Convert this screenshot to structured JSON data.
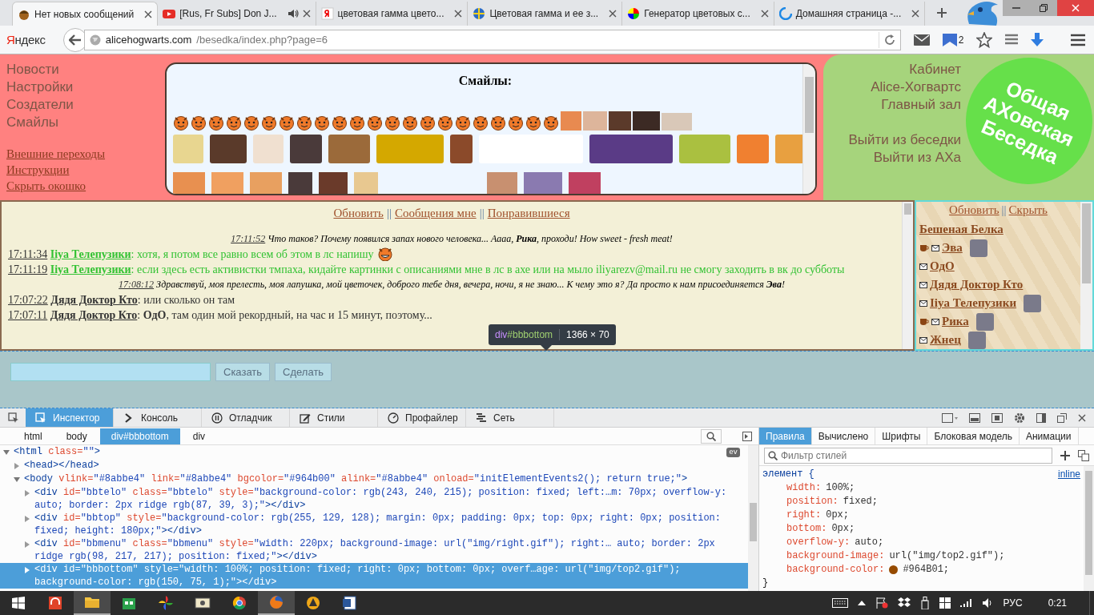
{
  "browser": {
    "tabs": [
      {
        "title": "Нет новых сообщений",
        "audio": false,
        "selected": true
      },
      {
        "title": "[Rus, Fr Subs] Don J...",
        "audio": true,
        "selected": false
      },
      {
        "title": "цветовая гамма цвето...",
        "audio": false,
        "selected": false
      },
      {
        "title": "Цветовая гамма и ее з...",
        "audio": false,
        "selected": false
      },
      {
        "title": "Генератор цветовых с...",
        "audio": false,
        "selected": false
      },
      {
        "title": "Домашняя страница -...",
        "audio": false,
        "selected": false
      }
    ],
    "brand": "Яндекс",
    "address": {
      "host": "alicehogwarts.com",
      "path": "/besedka/index.php?page=6"
    },
    "badge": "2"
  },
  "top": {
    "menu": [
      "Новости",
      "Настройки",
      "Создатели",
      "Смайлы"
    ],
    "links": [
      "Внешние переходы",
      "Инструкции",
      "Скрыть окошко"
    ],
    "smileys_title": "Смайлы:",
    "right_links": [
      "Кабинет",
      "Alice-Хогвартс",
      "Главный зал"
    ],
    "exit_links": [
      "Выйти из беседки",
      "Выйти из АХа"
    ],
    "logo": [
      "Общая",
      "АХовская",
      "Беседка"
    ]
  },
  "chat": {
    "nav": [
      {
        "kind": "link",
        "text": "Обновить"
      },
      {
        "kind": "separator",
        "text": "||"
      },
      {
        "kind": "link",
        "text": "Сообщения мне"
      },
      {
        "kind": "separator",
        "text": "||"
      },
      {
        "kind": "link",
        "text": "Понравившиеся"
      }
    ],
    "messages": [
      {
        "kind": "system",
        "time": "17:11:52",
        "text": "Что таков? Почему появился запах нового человека... Аааа, **Рика**, проходи! How sweet - fresh meat!"
      },
      {
        "kind": "post",
        "time": "17:11:34",
        "author": "Iiya Телепузики",
        "text": ": хотя, я потом все равно всем об этом в лс напишу",
        "color": "#33c233",
        "smiley": true
      },
      {
        "kind": "post",
        "time": "17:11:19",
        "author": "Iiya Телепузики",
        "text": ": если здесь есть активистки тмпаха, кидайте картинки с описаниями мне в лс в ахе или на мыло iliyarezv@mail.ru не смогу заходить в вк до субботы",
        "color": "#33c233",
        "smiley": false
      },
      {
        "kind": "system",
        "time": "17:08:12",
        "text": "Здравствуй, моя прелесть, моя лапушка, мой цветочек, доброго тебе дня, вечера, ночи, я не знаю... К чему это я? Да просто к нам присоединяется **Эва**!"
      },
      {
        "kind": "post",
        "time": "17:07:22",
        "author": "Дядя Доктор Кто",
        "text": ": или сколько он там",
        "color": "#333333",
        "smiley": false
      },
      {
        "kind": "post",
        "time": "17:07:11",
        "author": "Дядя Доктор Кто",
        "text": ": **ОдО**, там один мой рекордный, на час и 15 минут, поэтому...",
        "color": "#333333",
        "smiley": false
      }
    ],
    "sidebar": {
      "nav": [
        {
          "kind": "link",
          "text": "Обновить"
        },
        {
          "kind": "separator",
          "text": "||"
        },
        {
          "kind": "link",
          "text": "Скрыть"
        }
      ],
      "users": [
        {
          "name": "Бешеная Белка",
          "mail": false,
          "cup": false,
          "avatar": false
        },
        {
          "name": "Эва",
          "mail": true,
          "cup": true,
          "avatar": true
        },
        {
          "name": "ОдО",
          "mail": true,
          "cup": false,
          "avatar": false
        },
        {
          "name": "Дядя Доктор Кто",
          "mail": true,
          "cup": false,
          "avatar": false
        },
        {
          "name": "Iiya Телепузики",
          "mail": true,
          "cup": false,
          "avatar": true
        },
        {
          "name": "Рика",
          "mail": true,
          "cup": true,
          "avatar": true
        },
        {
          "name": "Жнец",
          "mail": true,
          "cup": false,
          "avatar": true
        }
      ]
    }
  },
  "bottom": {
    "buttons": [
      "Сказать",
      "Сделать"
    ]
  },
  "tooltip": {
    "tag": "div",
    "id": "#bbbottom",
    "size": "1366 × 70"
  },
  "devtools": {
    "tabs": [
      {
        "label": "Инспектор",
        "selected": true
      },
      {
        "label": "Консоль",
        "selected": false
      },
      {
        "label": "Отладчик",
        "selected": false
      },
      {
        "label": "Стили",
        "selected": false
      },
      {
        "label": "Профайлер",
        "selected": false
      },
      {
        "label": "Сеть",
        "selected": false
      }
    ],
    "breadcrumbs": [
      {
        "label": "html",
        "selected": false
      },
      {
        "label": "body",
        "selected": false
      },
      {
        "label": "div#bbbottom",
        "selected": true
      },
      {
        "label": "div",
        "selected": false
      }
    ],
    "markup": [
      {
        "expanded": true,
        "selected": false,
        "badge": "ev",
        "tokens": [
          {
            "kind": "tag",
            "text": "<html"
          },
          {
            "kind": "attr",
            "text": " class="
          },
          {
            "kind": "val",
            "text": "\"\""
          },
          {
            "kind": "tag",
            "text": ">"
          }
        ],
        "children": [
          {
            "expanded": false,
            "selected": false,
            "tokens": [
              {
                "kind": "tag",
                "text": "<head></head>"
              }
            ]
          },
          {
            "expanded": true,
            "selected": false,
            "tokens": [
              {
                "kind": "tag",
                "text": "<body"
              },
              {
                "kind": "attr",
                "text": " vlink="
              },
              {
                "kind": "val",
                "text": "\"#8abbe4\""
              },
              {
                "kind": "attr",
                "text": " link="
              },
              {
                "kind": "val",
                "text": "\"#8abbe4\""
              },
              {
                "kind": "attr",
                "text": " bgcolor="
              },
              {
                "kind": "val",
                "text": "\"#964b00\""
              },
              {
                "kind": "attr",
                "text": " alink="
              },
              {
                "kind": "val",
                "text": "\"#8abbe4\""
              },
              {
                "kind": "attr",
                "text": " onload="
              },
              {
                "kind": "val",
                "text": "\"initElementEvents2(); return true;\""
              },
              {
                "kind": "tag",
                "text": ">"
              }
            ],
            "children": [
              {
                "expanded": false,
                "selected": false,
                "tokens": [
                  {
                    "kind": "tag",
                    "text": "<div"
                  },
                  {
                    "kind": "attr",
                    "text": " id="
                  },
                  {
                    "kind": "val",
                    "text": "\"bbtelo\""
                  },
                  {
                    "kind": "attr",
                    "text": " class="
                  },
                  {
                    "kind": "val",
                    "text": "\"bbtelo\""
                  },
                  {
                    "kind": "attr",
                    "text": " style="
                  },
                  {
                    "kind": "val",
                    "text": "\"background-color: rgb(243, 240, 215); position: fixed; left:…m: 70px; overflow-y: auto; border: 2px ridge rgb(87, 39, 3);\""
                  },
                  {
                    "kind": "tag",
                    "text": "></div>"
                  }
                ]
              },
              {
                "expanded": false,
                "selected": false,
                "tokens": [
                  {
                    "kind": "tag",
                    "text": "<div"
                  },
                  {
                    "kind": "attr",
                    "text": " id="
                  },
                  {
                    "kind": "val",
                    "text": "\"bbtop\""
                  },
                  {
                    "kind": "attr",
                    "text": " style="
                  },
                  {
                    "kind": "val",
                    "text": "\"background-color: rgb(255, 129, 128); margin: 0px; padding: 0px; top: 0px; right: 0px; position: fixed; height: 180px;\""
                  },
                  {
                    "kind": "tag",
                    "text": "></div>"
                  }
                ]
              },
              {
                "expanded": false,
                "selected": false,
                "tokens": [
                  {
                    "kind": "tag",
                    "text": "<div"
                  },
                  {
                    "kind": "attr",
                    "text": " id="
                  },
                  {
                    "kind": "val",
                    "text": "\"bbmenu\""
                  },
                  {
                    "kind": "attr",
                    "text": " class="
                  },
                  {
                    "kind": "val",
                    "text": "\"bbmenu\""
                  },
                  {
                    "kind": "attr",
                    "text": " style="
                  },
                  {
                    "kind": "val",
                    "text": "\"width: 220px; background-image: url(\"img/right.gif\"); right:… auto; border: 2px ridge rgb(98, 217, 217); position: fixed;\""
                  },
                  {
                    "kind": "tag",
                    "text": "></div>"
                  }
                ]
              },
              {
                "expanded": false,
                "selected": true,
                "tokens": [
                  {
                    "kind": "tag",
                    "text": "<div"
                  },
                  {
                    "kind": "attr",
                    "text": " id="
                  },
                  {
                    "kind": "val",
                    "text": "\"bbbottom\""
                  },
                  {
                    "kind": "attr",
                    "text": " style="
                  },
                  {
                    "kind": "val",
                    "text": "\"width: 100%; position: fixed; right: 0px; bottom: 0px; overf…age: url(\"img/top2.gif\"); background-color: rgb(150, 75, 1);\""
                  },
                  {
                    "kind": "tag",
                    "text": "></div>"
                  }
                ]
              }
            ]
          }
        ]
      }
    ],
    "side_tabs": [
      {
        "label": "Правила",
        "selected": true
      },
      {
        "label": "Вычислено",
        "selected": false
      },
      {
        "label": "Шрифты",
        "selected": false
      },
      {
        "label": "Блоковая модель",
        "selected": false
      },
      {
        "label": "Анимации",
        "selected": false
      }
    ],
    "filter": {
      "placeholder": "Фильтр стилей"
    },
    "rule": {
      "selector": "элемент",
      "open": "{",
      "source": "inline",
      "close": "}",
      "declarations": [
        {
          "name": "width:",
          "value": "100%;"
        },
        {
          "name": "position:",
          "value": "fixed;"
        },
        {
          "name": "right:",
          "value": "0px;"
        },
        {
          "name": "bottom:",
          "value": "0px;"
        },
        {
          "name": "overflow-y:",
          "value": "auto;"
        },
        {
          "name": "background-image:",
          "value": "url(\"img/top2.gif\");"
        },
        {
          "name": "background-color:",
          "value": "#964B01;",
          "color": "#964b01"
        }
      ]
    }
  },
  "taskbar": {
    "apps": [
      {
        "kind": "audio",
        "selected": false
      },
      {
        "kind": "folder",
        "selected": true
      },
      {
        "kind": "store",
        "selected": false
      },
      {
        "kind": "photos",
        "selected": false
      },
      {
        "kind": "viewer",
        "selected": false
      },
      {
        "kind": "chrome",
        "selected": false
      },
      {
        "kind": "firefox",
        "selected": true
      },
      {
        "kind": "player",
        "selected": false
      },
      {
        "kind": "word",
        "selected": false
      }
    ],
    "language": "РУС",
    "time": "0:21"
  }
}
